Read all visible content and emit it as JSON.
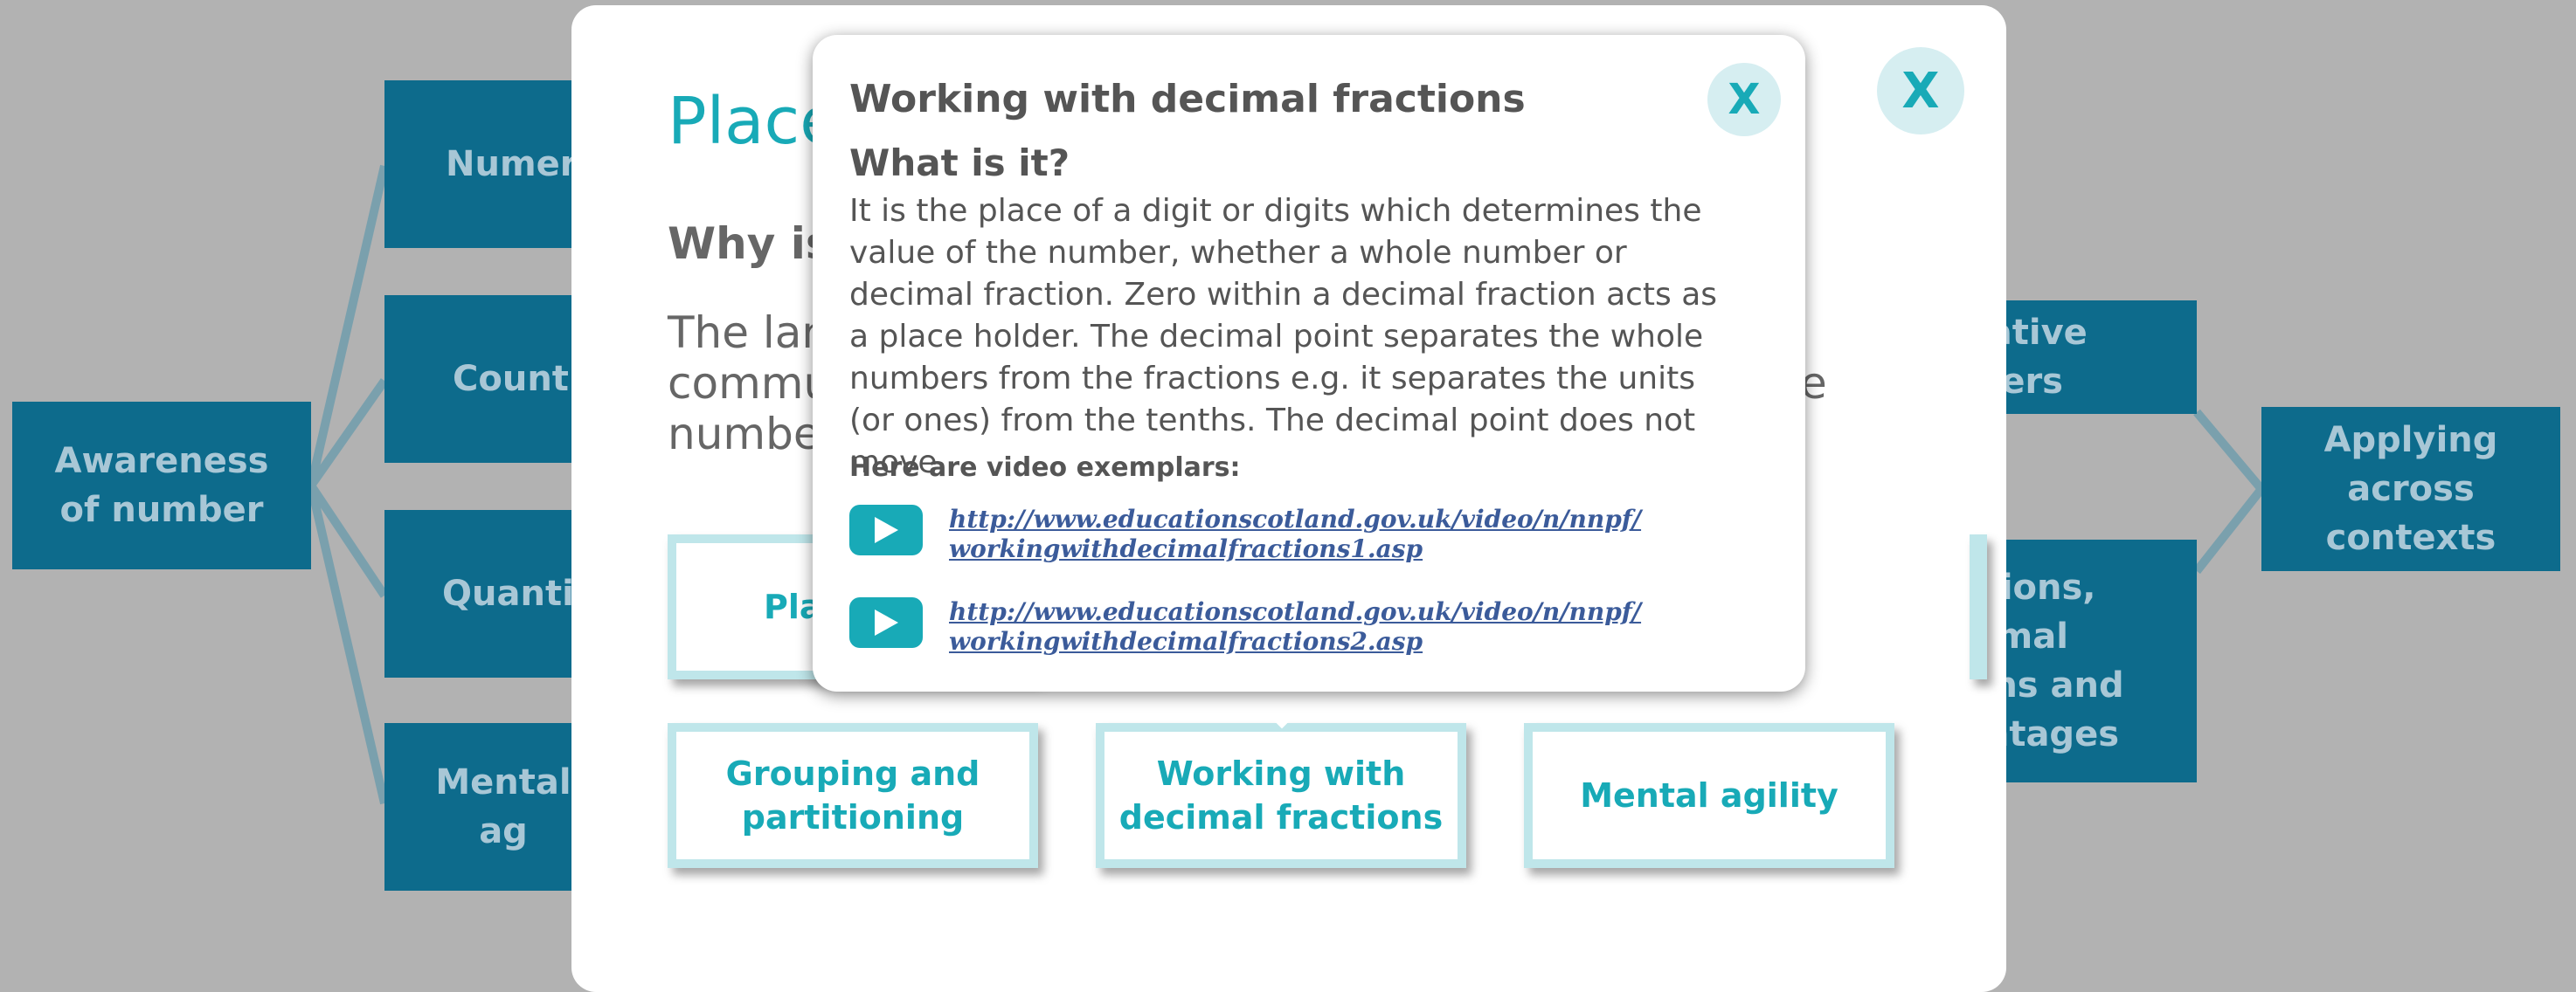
{
  "background": {
    "left_node": "Awareness of number",
    "branch_items": [
      "Numer",
      "Counti",
      "Quantit",
      "Mental ag"
    ],
    "right_items": [
      "egative\nmbers",
      "actions,\necimal\ntions and\ncentages"
    ],
    "right_node": "Applying across contexts"
  },
  "modal": {
    "title": "Place",
    "subtitle": "Why is",
    "body_lines": [
      "The lan",
      "commu",
      "number"
    ],
    "body_right_char": "e",
    "close": "X",
    "cards": [
      "Pla",
      "Grouping and partitioning",
      "Working with decimal fractions",
      "Mental agility"
    ]
  },
  "popup": {
    "title": "Working with decimal fractions",
    "close": "X",
    "heading": "What is it?",
    "description": "It is the place of a digit or digits which determines the value of the number, whether a whole number or decimal fraction. Zero within a decimal fraction acts as a place holder. The decimal point separates the whole numbers from the fractions e.g. it separates the units (or ones) from the tenths. The decimal point does not move.",
    "video_label": "Here are video exemplars:",
    "videos": [
      {
        "line1": "http://www.educationscotland.gov.uk/video/n/nnpf/",
        "line2": "workingwithdecimalfractions1.asp"
      },
      {
        "line1": "http://www.educationscotland.gov.uk/video/n/nnpf/",
        "line2": "workingwithdecimalfractions2.asp"
      }
    ]
  },
  "colors": {
    "overlay": "#b2b2b2",
    "box": "#0d6b8c",
    "accent": "#18aab7",
    "link": "#3b5b9a"
  }
}
